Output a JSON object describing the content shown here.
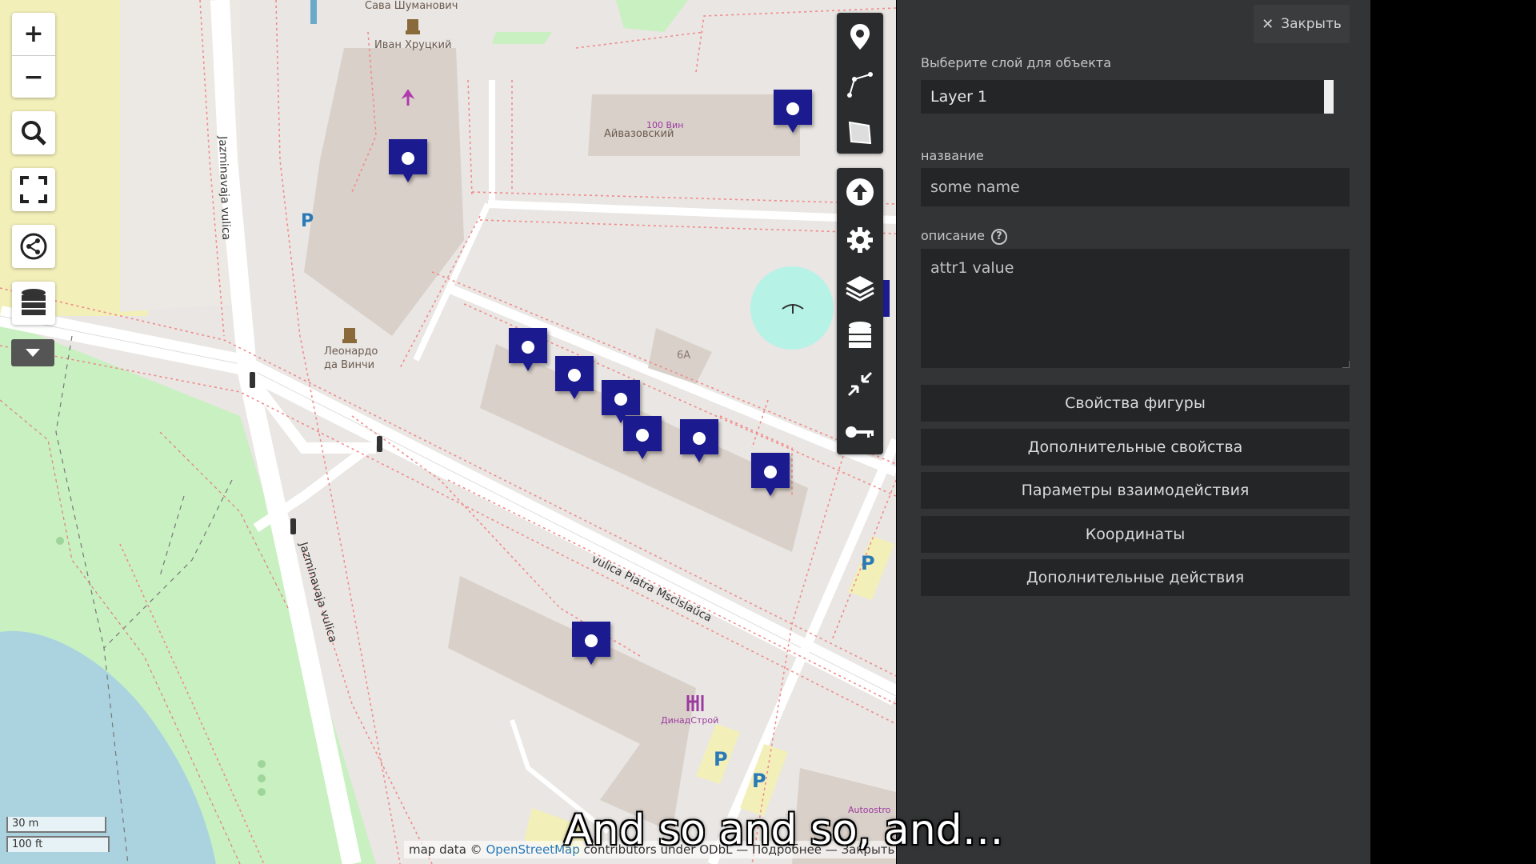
{
  "map": {
    "labels": {
      "sava": "Сава Шуманович",
      "ivan": "Иван Хруцкий",
      "aivazovsky": "Айвазовский",
      "vin": "100 Вин",
      "leonardo_1": "Леонардо",
      "leonardo_2": "да Винчи",
      "building_6a": "6А",
      "dinadstroy": "ДинадСтрой",
      "autostop": "Autoostro",
      "street_jazmin_1": "Jazminavaja vulica",
      "street_jazmin_2": "Jazminavaja vulica",
      "street_piatra": "vulica Piatra Mscislaŭca",
      "parking": "P"
    },
    "scale": {
      "metric": "30 m",
      "imperial": "100 ft"
    },
    "attribution": {
      "prefix": "map data ©",
      "link": "OpenStreetMap",
      "rest": "contributors under ODbL — Подробнее — Закрыть"
    },
    "colors": {
      "marker": "#1c1a8f",
      "park": "#c8f0c0",
      "water": "#aad3df",
      "building": "#d9d0c9",
      "sand": "#f3efb9"
    }
  },
  "left_controls": {
    "zoom_in": "+",
    "zoom_out": "−",
    "icons": [
      "search-icon",
      "fullscreen-icon",
      "share-icon",
      "database-icon",
      "dropdown-icon"
    ]
  },
  "toolbar": {
    "draw_group": [
      "marker-icon",
      "polyline-icon",
      "polygon-icon"
    ],
    "tools_group": [
      "upload-icon",
      "gear-icon",
      "layers-icon",
      "database-icon",
      "collapse-icon",
      "key-icon"
    ]
  },
  "panel": {
    "close_label": "Закрыть",
    "layer_label": "Выберите слой для объекта",
    "layer_value": "Layer 1",
    "name_label": "название",
    "name_value": "some name",
    "description_label": "описание",
    "help_glyph": "?",
    "description_value": "attr1 value",
    "buttons": {
      "shape_props": "Свойства фигуры",
      "extra_props": "Дополнительные свойства",
      "interaction": "Параметры взаимодействия",
      "coords": "Координаты",
      "extra_actions": "Дополнительные действия"
    }
  },
  "subtitle": "And so and so, and…"
}
